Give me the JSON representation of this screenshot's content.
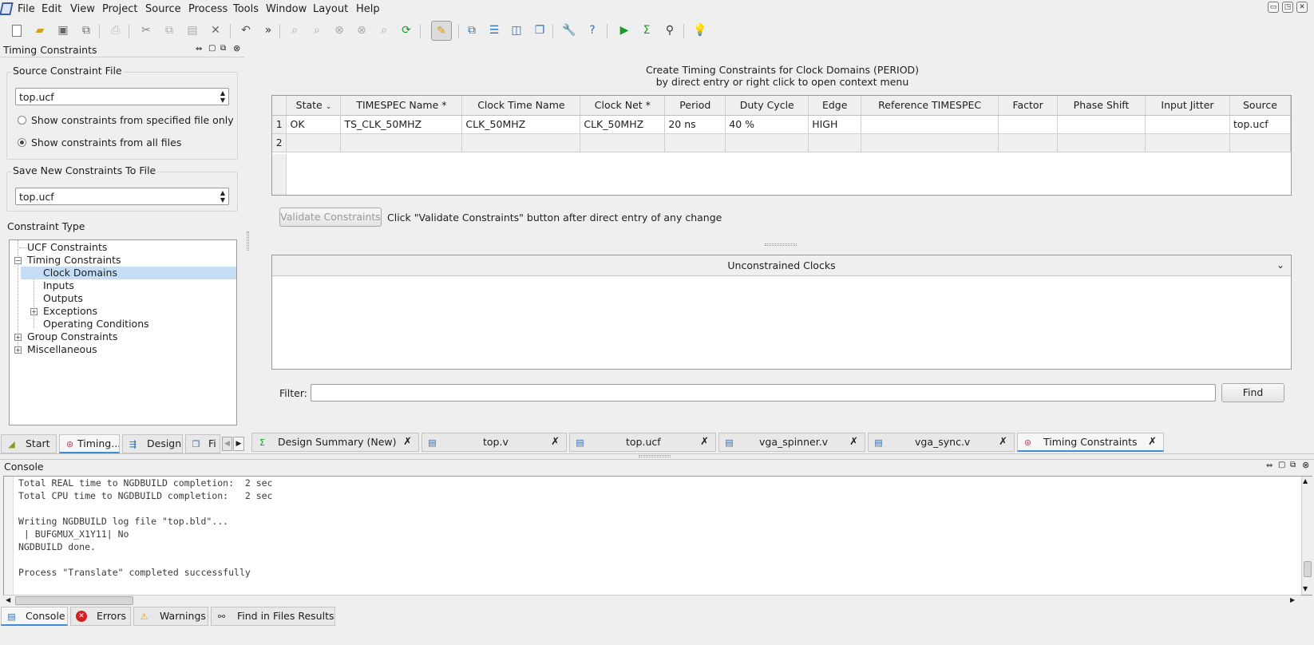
{
  "menu": [
    "File",
    "Edit",
    "View",
    "Project",
    "Source",
    "Process",
    "Tools",
    "Window",
    "Layout",
    "Help"
  ],
  "panel_title": "Timing Constraints",
  "source_constraint": {
    "label": "Source Constraint File",
    "file": "top.ucf",
    "opt1": "Show constraints from specified file only",
    "opt2": "Show constraints from all files"
  },
  "save_new": {
    "label": "Save New Constraints To File",
    "file": "top.ucf"
  },
  "constraint_type": {
    "label": "Constraint Type",
    "items": [
      "UCF Constraints",
      "Timing Constraints",
      "Clock Domains",
      "Inputs",
      "Outputs",
      "Exceptions",
      "Operating Conditions",
      "Group Constraints",
      "Miscellaneous"
    ]
  },
  "main": {
    "heading1": "Create Timing Constraints for Clock Domains (PERIOD)",
    "heading2": "by direct entry or right click to open context menu",
    "columns": [
      "State",
      "TIMESPEC Name *",
      "Clock Time Name",
      "Clock Net *",
      "Period",
      "Duty Cycle",
      "Edge",
      "Reference TIMESPEC",
      "Factor",
      "Phase Shift",
      "Input Jitter",
      "Source"
    ],
    "rows": [
      [
        "1",
        "OK",
        "TS_CLK_50MHZ",
        "CLK_50MHZ",
        "CLK_50MHZ",
        "20 ns",
        "40 %",
        "HIGH",
        "",
        "",
        "",
        "",
        "top.ucf"
      ],
      [
        "2",
        "",
        "",
        "",
        "",
        "",
        "",
        "",
        "",
        "",
        "",
        "",
        ""
      ]
    ],
    "validate_button": "Validate Constraints",
    "validate_hint": "Click \"Validate Constraints\" button after direct entry of any change",
    "unconstrained": "Unconstrained Clocks",
    "filter_label": "Filter:",
    "filter_value": "",
    "find_button": "Find"
  },
  "left_tabs": [
    "Start",
    "Timing...",
    "Design",
    "Fi"
  ],
  "doc_tabs": [
    "Design Summary (New)",
    "top.v",
    "top.ucf",
    "vga_spinner.v",
    "vga_sync.v",
    "Timing Constraints"
  ],
  "console": {
    "title": "Console",
    "lines": [
      "Total REAL time to NGDBUILD completion:  2 sec",
      "Total CPU time to NGDBUILD completion:   2 sec",
      "",
      "Writing NGDBUILD log file \"top.bld\"...",
      " | BUFGMUX_X1Y11| No",
      "NGDBUILD done.",
      "",
      "Process \"Translate\" completed successfully"
    ]
  },
  "bottom_tabs": [
    "Console",
    "Errors",
    "Warnings",
    "Find in Files Results"
  ],
  "colors": {
    "selection": "#c5def5",
    "accent": "#3c8fd6",
    "error_red": "#d62020",
    "run_green": "#1c9a2a"
  }
}
